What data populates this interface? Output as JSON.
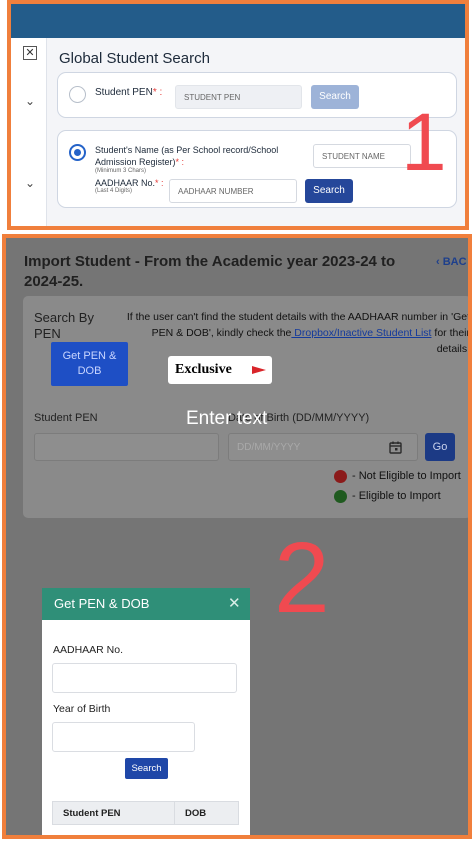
{
  "panel1": {
    "title": "Global Student Search",
    "number_marker": "1",
    "student_pen": {
      "label": "Student PEN",
      "required_mark": "* :",
      "placeholder": "STUDENT PEN",
      "button": "Search",
      "selected": false
    },
    "student_name": {
      "label_line1": "Student's Name (as Per School record/School",
      "label_line2": "Admission Register)",
      "required_mark": "* :",
      "hint": "(Minimum 3 Chars)",
      "placeholder": "STUDENT NAME",
      "selected": true
    },
    "aadhaar": {
      "label": "AADHAAR No.",
      "required_mark": "* :",
      "hint": "(Last 4 Digits)",
      "placeholder": "AADHAAR NUMBER",
      "button": "Search"
    },
    "sidebar": {
      "close_glyph": "✕",
      "chevron_glyph": "⌄"
    }
  },
  "panel2": {
    "number_marker": "2",
    "heading": "Import Student - From the Academic year 2023-24 to 2024-25.",
    "back_label": "‹ BAC",
    "search_by_label": "Search By PEN",
    "get_pen_button": "Get PEN & DOB",
    "info_text_part1": "If the user can't find the student details with the AADHAAR number in 'Get PEN & DOB', kindly check the",
    "info_link": " Dropbox/Inactive Student List",
    "info_text_part2": " for their details.",
    "exclusive_badge": "Exclusive",
    "overlay_text": "Enter text",
    "student_pen_label": "Student PEN",
    "dob_label": "Date of Birth (DD/MM/YYYY)",
    "dob_placeholder": "DD/MM/YYYY",
    "go_button": "Go",
    "legend": [
      {
        "label": "- Not Eligible to Import",
        "color": "#8b1a1a"
      },
      {
        "label": "- Eligible to Import",
        "color": "#1f5a1f"
      }
    ],
    "modal": {
      "title": "Get PEN & DOB",
      "close_glyph": "✕",
      "aadhaar_label": "AADHAAR No.",
      "year_label": "Year of Birth",
      "search_button": "Search",
      "table_headers": [
        "Student PEN",
        "DOB"
      ]
    }
  },
  "colors": {
    "frame_border": "#f07f3c",
    "marker": "#f04a50",
    "primary_blue": "#25479a",
    "modal_header": "#2f8f78"
  }
}
